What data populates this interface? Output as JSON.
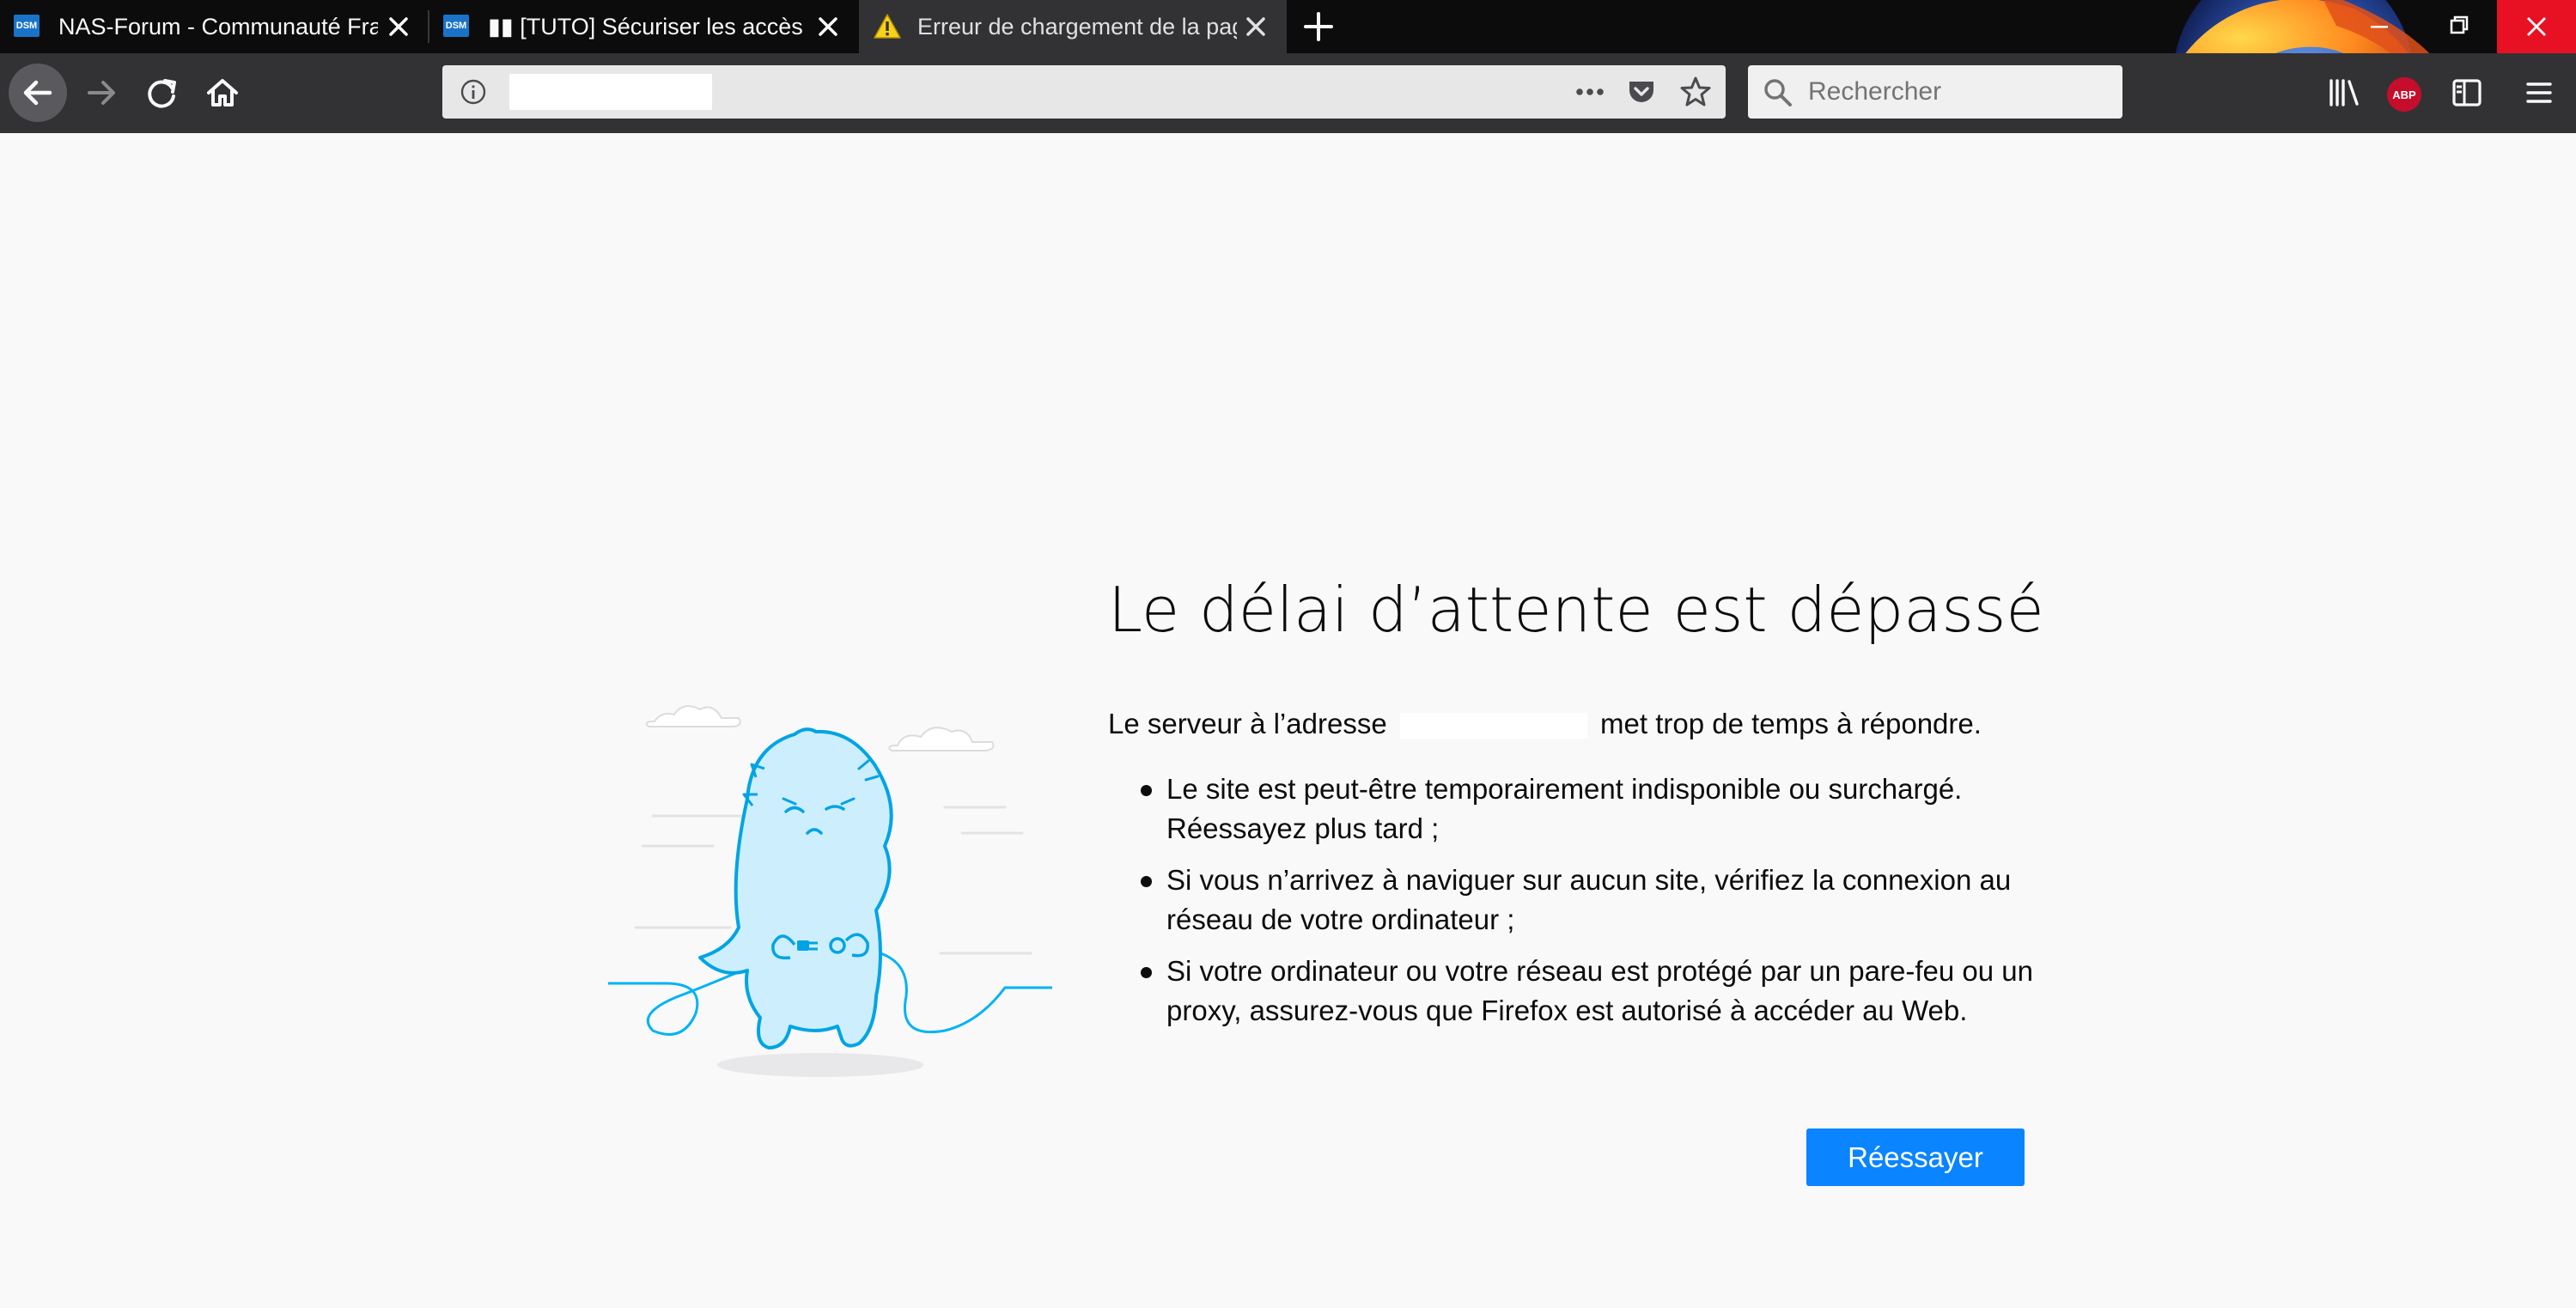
{
  "browser": {
    "tabs": [
      {
        "title": "NAS-Forum - Communauté Fra",
        "favicon": "dsm-icon",
        "favicon_text": "DSM",
        "active": false
      },
      {
        "title": "▮▮ [TUTO] Sécuriser les accès à",
        "favicon": "dsm-icon",
        "favicon_text": "DSM",
        "active": false
      },
      {
        "title": "Erreur de chargement de la pag",
        "favicon": "warning-icon",
        "active": true
      }
    ],
    "toolbar": {
      "search_placeholder": "Rechercher",
      "url_value": ""
    },
    "addons": {
      "abp_label": "ABP"
    },
    "colors": {
      "accent": "#0a84ff",
      "tabstrip": "#0c0c0d",
      "navbar": "#323234",
      "close_hover": "#e81123"
    }
  },
  "error_page": {
    "title": "Le délai d’attente est dépassé",
    "server_prefix": "Le serveur à l’adresse",
    "server_suffix": "met trop de temps à répondre.",
    "reasons": [
      "Le site est peut-être temporairement indisponible ou surchargé. Réessayez plus tard ;",
      "Si vous n’arrivez à naviguer sur aucun site, vérifiez la connexion au réseau de votre ordinateur ;",
      "Si votre ordinateur ou votre réseau est protégé par un pare-feu ou un proxy, assurez-vous que Firefox est autorisé à accéder au Web."
    ],
    "retry_label": "Réessayer"
  }
}
